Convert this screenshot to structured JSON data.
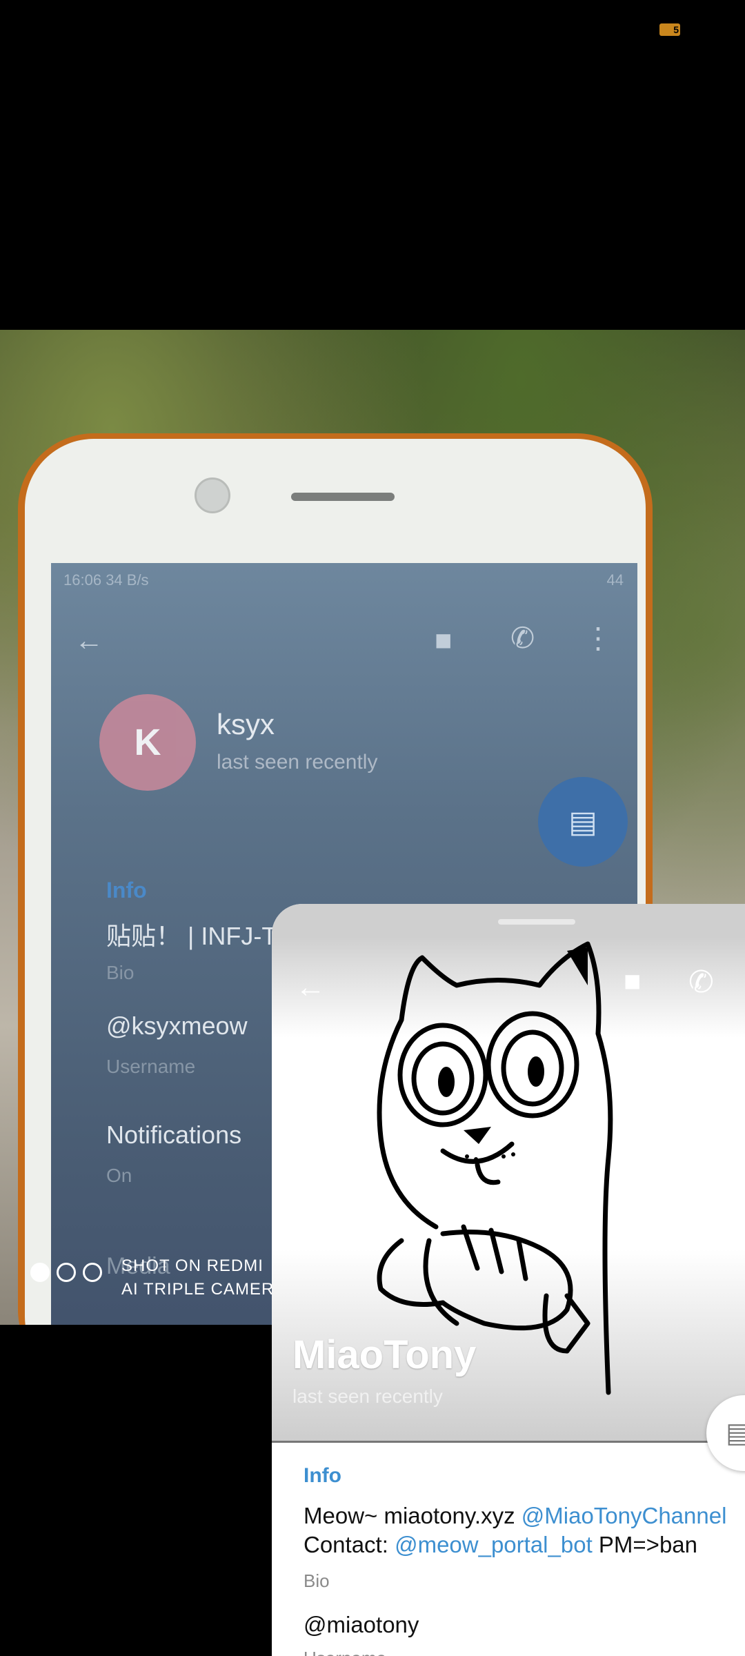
{
  "status": {
    "battery": "5"
  },
  "photo": {
    "inner_screen": {
      "status_time": "16:06",
      "status_speed": "34 B/s",
      "status_right": "44",
      "avatar_letter": "K",
      "name": "ksyx",
      "last_seen": "last seen recently",
      "info_label": "Info",
      "bio_value": "贴贴！ | INFJ-T",
      "bio_label": "Bio",
      "username_value": "@ksyxmeow",
      "username_label": "Username",
      "notifications_label": "Notifications",
      "notifications_value": "On",
      "media_label": "Media"
    },
    "watermark": {
      "line1": "SHOT ON REDMI",
      "line2": "AI TRIPLE CAMERA"
    }
  },
  "profile": {
    "name": "MiaoTony",
    "last_seen": "last seen recently",
    "info_label": "Info",
    "bio_text_1": "Meow~ miaotony.xyz ",
    "bio_link_1": "@MiaoTonyChannel",
    "bio_text_2": "Contact: ",
    "bio_link_2": "@meow_portal_bot",
    "bio_text_3": " PM=>ban",
    "bio_label": "Bio",
    "username": "@miaotony",
    "username_label": "Username"
  },
  "icons": {
    "back": "arrow-left",
    "video": "video-camera",
    "phone": "phone",
    "more": "more-vertical",
    "message": "message-square"
  },
  "colors": {
    "link": "#3d8fd0",
    "phone_case": "#c46c1c"
  }
}
